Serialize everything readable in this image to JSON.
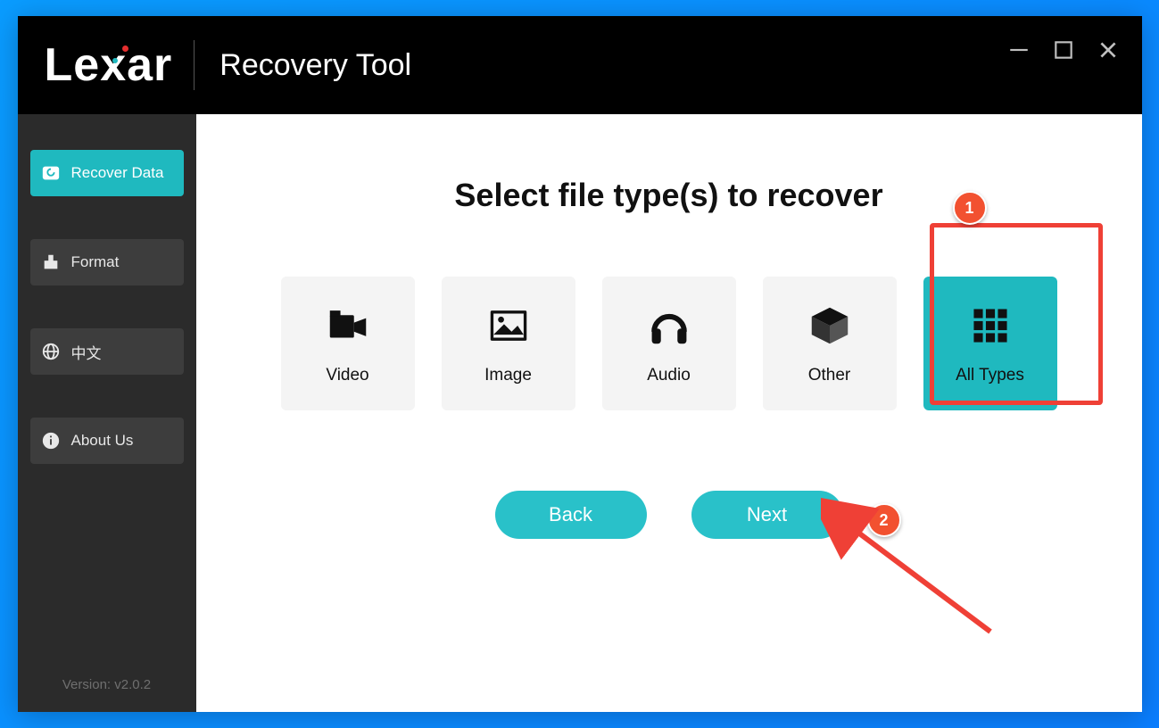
{
  "brand": "Lexar",
  "app_title": "Recovery Tool",
  "sidebar": {
    "items": [
      {
        "id": "recover-data",
        "label": "Recover Data",
        "active": true
      },
      {
        "id": "format",
        "label": "Format",
        "active": false
      },
      {
        "id": "language",
        "label": "中文",
        "active": false
      },
      {
        "id": "about",
        "label": "About Us",
        "active": false
      }
    ],
    "version": "Version: v2.0.2"
  },
  "main": {
    "heading": "Select file type(s) to recover",
    "tiles": [
      {
        "id": "video",
        "label": "Video",
        "selected": false
      },
      {
        "id": "image",
        "label": "Image",
        "selected": false
      },
      {
        "id": "audio",
        "label": "Audio",
        "selected": false
      },
      {
        "id": "other",
        "label": "Other",
        "selected": false
      },
      {
        "id": "all-types",
        "label": "All Types",
        "selected": true
      }
    ],
    "back_label": "Back",
    "next_label": "Next"
  },
  "annotations": {
    "badge1": "1",
    "badge2": "2"
  }
}
